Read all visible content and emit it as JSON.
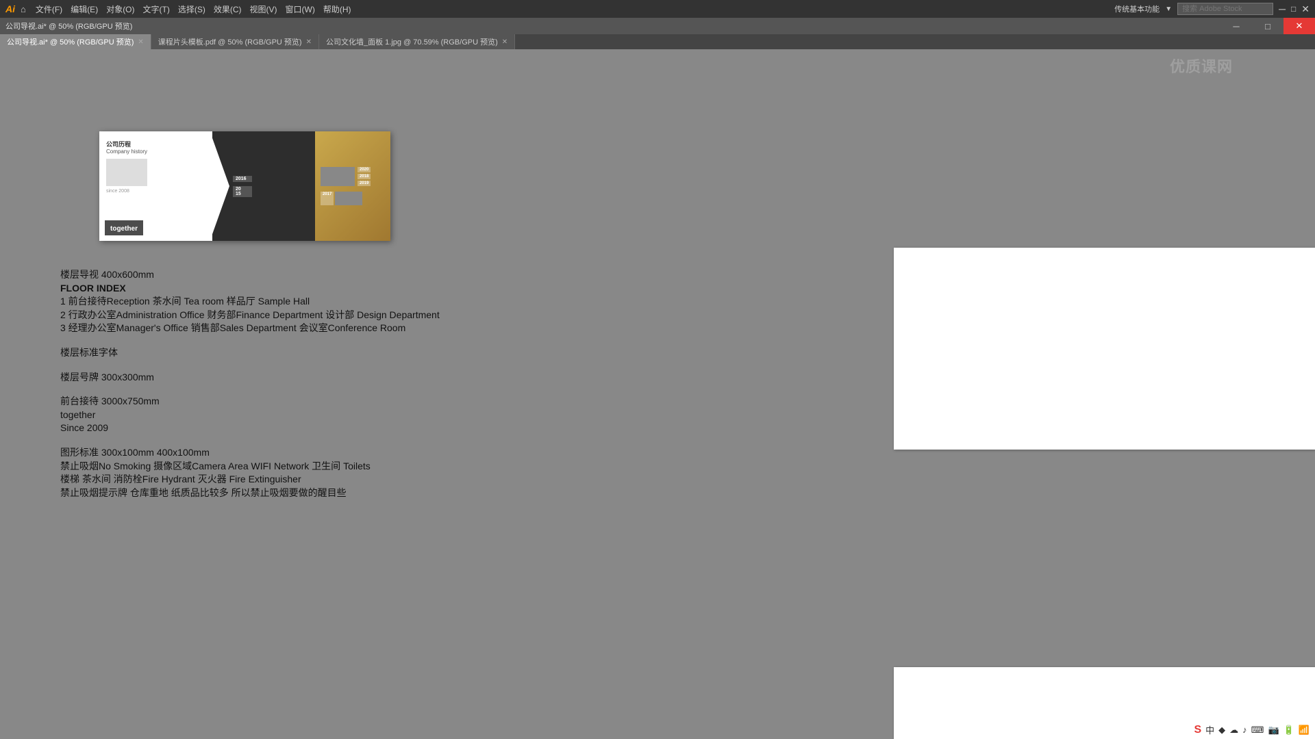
{
  "app": {
    "logo": "Ai",
    "title": "公司导视.ai* @ 50% (RGB/GPU 预览)"
  },
  "menubar": {
    "items": [
      "文件(F)",
      "编辑(E)",
      "对象(O)",
      "文字(T)",
      "选择(S)",
      "效果(C)",
      "视图(V)",
      "窗口(W)",
      "帮助(H)"
    ],
    "right_text": "传统基本功能",
    "search_placeholder": "搜索 Adobe Stock",
    "workspace_icon": "▦"
  },
  "tabs": [
    {
      "label": "公司导视.ai* @ 50% (RGB/GPU 预览)",
      "active": true
    },
    {
      "label": "课程片头模板.pdf @ 50% (RGB/GPU 预览)",
      "active": false
    },
    {
      "label": "公司文化墙_面板 1.jpg @ 70.59% (RGB/GPU 预览)",
      "active": false
    }
  ],
  "main_content": {
    "section1": {
      "line1": "楼层导视 400x600mm",
      "line2": "FLOOR INDEX",
      "line3": "1  前台接待Reception  茶水间 Tea room 样品厅 Sample Hall",
      "line4": "2 行政办公室Administration Office 财务部Finance Department 设计部 Design Department",
      "line5": "3 经理办公室Manager's Office 销售部Sales Department 会议室Conference Room"
    },
    "section2": {
      "line1": "楼层标准字体"
    },
    "section3": {
      "line1": "楼层号牌 300x300mm"
    },
    "section4": {
      "line1": "前台接待 3000x750mm",
      "line2": "together",
      "line3": "Since 2009"
    },
    "section5": {
      "line1": "图形标准 300x100mm  400x100mm",
      "line2": "禁止吸烟No Smoking 摄像区域Camera Area WIFI Network 卫生间 Toilets",
      "line3": "楼梯 茶水间 消防栓Fire Hydrant 灭火器 Fire Extinguisher",
      "line4": "禁止吸烟提示牌 仓库重地 纸质品比较多 所以禁止吸烟要做的醒目些"
    }
  },
  "preview": {
    "title_cn": "公司历程",
    "title_en": "Company history",
    "together": "together",
    "since": "since 2008",
    "years": [
      "2016",
      "2015",
      "2018",
      "2019",
      "2017",
      "2020"
    ]
  },
  "taskbar": {
    "sougou_label": "S",
    "icons": [
      "中",
      "♦",
      "☁",
      "♪",
      "⌨",
      "🖫",
      "📷",
      "🔋"
    ]
  },
  "watermark": "优质课网"
}
